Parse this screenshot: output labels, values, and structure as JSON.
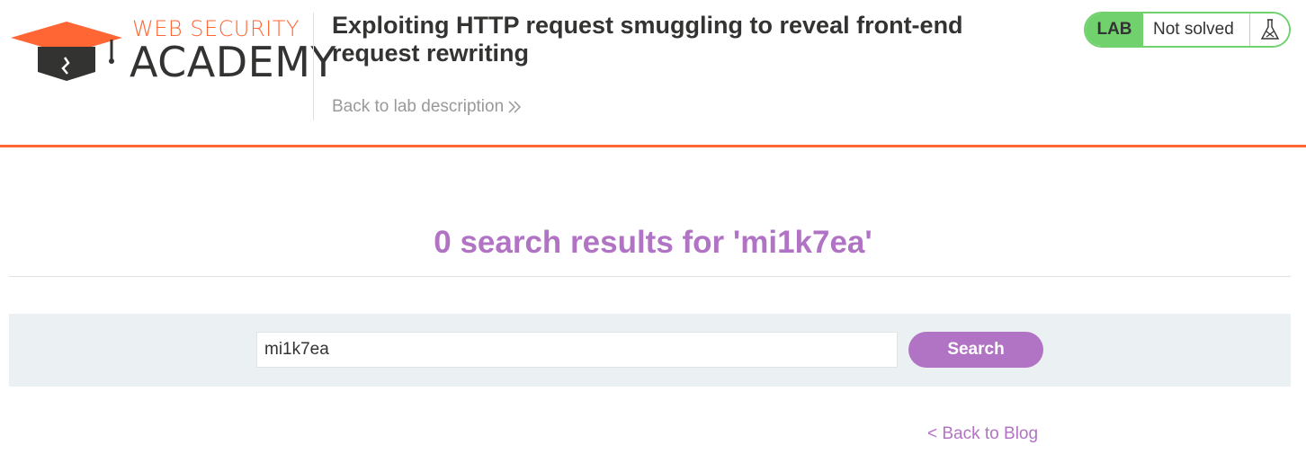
{
  "header": {
    "logo_top": "WEB SECURITY",
    "logo_main": "ACADEMY",
    "lab_title": "Exploiting HTTP request smuggling to reveal front-end request rewriting",
    "back_to_description": "Back to lab description",
    "status": {
      "label": "LAB",
      "state": "Not solved",
      "icon": "flask-icon"
    }
  },
  "results": {
    "heading": "0 search results for 'mi1k7ea'"
  },
  "search": {
    "value": "mi1k7ea",
    "button_label": "Search"
  },
  "footer": {
    "back_to_blog": "< Back to Blog"
  },
  "colors": {
    "accent_orange": "#ff6633",
    "purple": "#b173c4",
    "green": "#70d16d",
    "band": "#ebf0f2"
  }
}
